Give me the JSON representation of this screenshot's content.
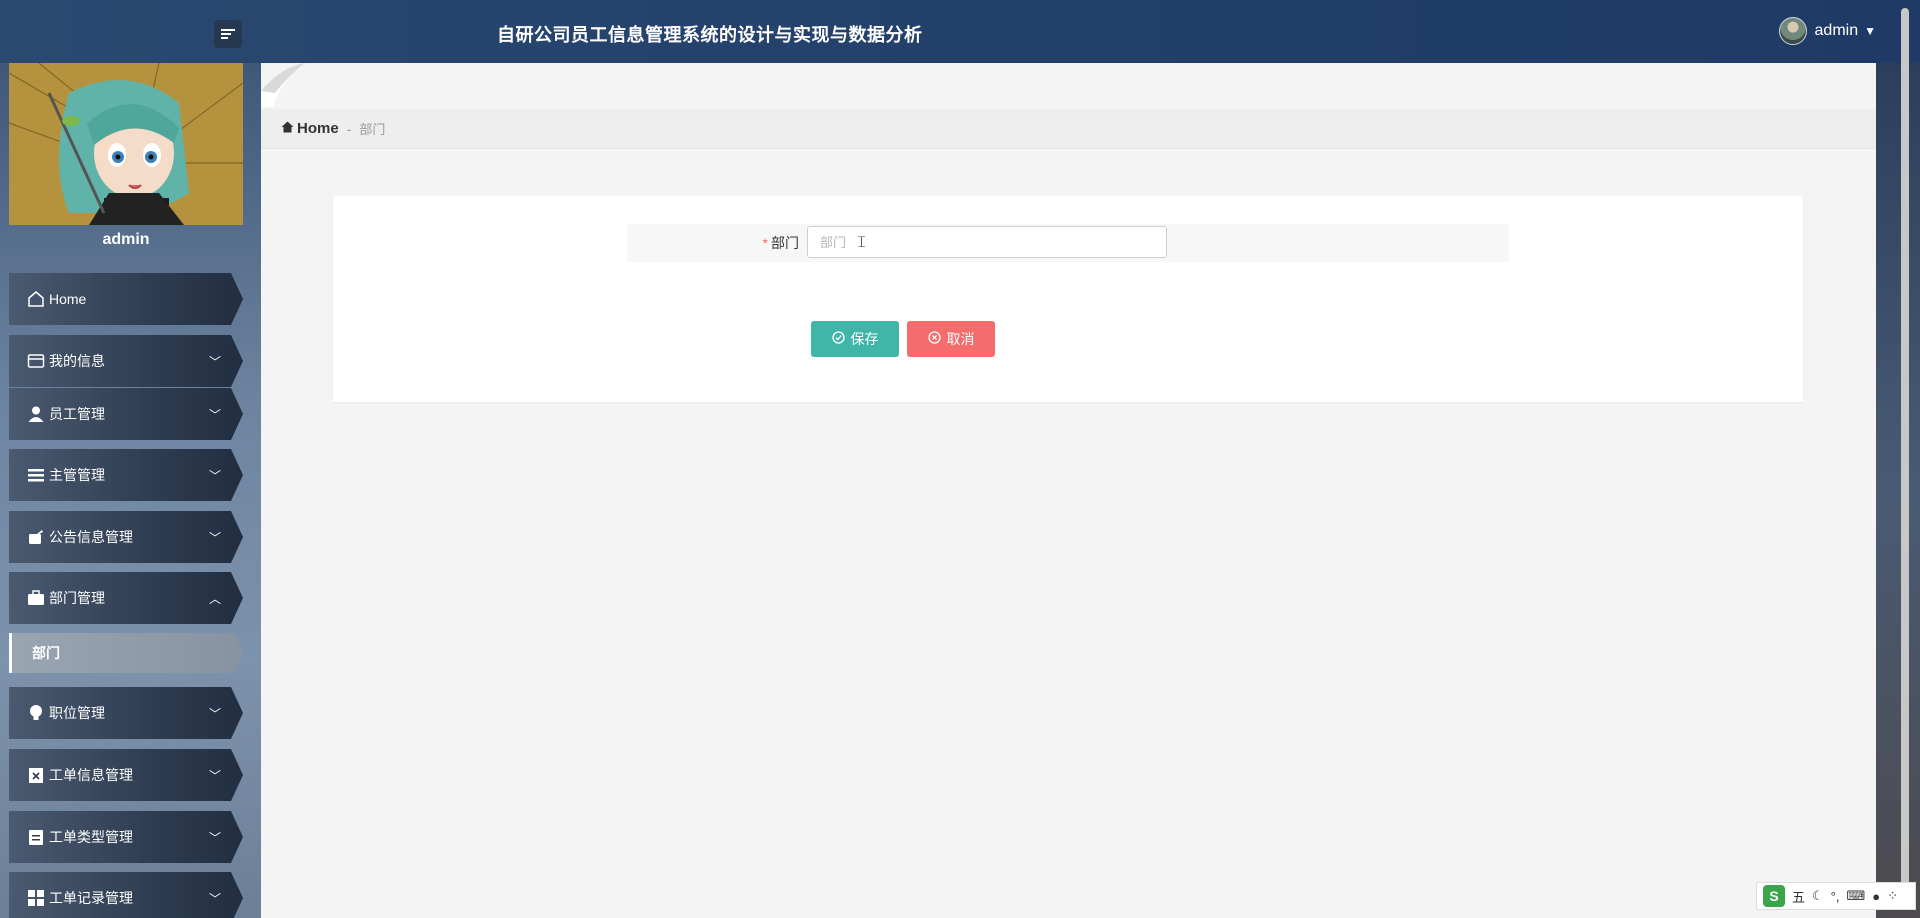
{
  "header": {
    "title": "自研公司员工信息管理系统的设计与实现与数据分析",
    "username": "admin"
  },
  "sidebar": {
    "username": "admin",
    "items": [
      {
        "label": "Home",
        "icon": "home-icon"
      },
      {
        "label": "我的信息",
        "icon": "wallet-icon"
      },
      {
        "label": "员工管理",
        "icon": "user-icon"
      },
      {
        "label": "主管管理",
        "icon": "list-icon"
      },
      {
        "label": "公告信息管理",
        "icon": "megaphone-icon"
      },
      {
        "label": "部门管理",
        "icon": "briefcase-icon",
        "expanded": true
      },
      {
        "label": "职位管理",
        "icon": "bulb-icon"
      },
      {
        "label": "工单信息管理",
        "icon": "clipboard-x-icon"
      },
      {
        "label": "工单类型管理",
        "icon": "clipboard-icon"
      },
      {
        "label": "工单记录管理",
        "icon": "grid-icon"
      }
    ],
    "submenu": {
      "label": "部门"
    }
  },
  "breadcrumb": {
    "home": "Home",
    "separator": "-",
    "current": "部门"
  },
  "form": {
    "field_label": "部门",
    "required_mark": "*",
    "field_placeholder": "部门",
    "field_value": "",
    "save_label": "保存",
    "cancel_label": "取消"
  },
  "ime": {
    "logo": "S",
    "mode": "五"
  },
  "colors": {
    "save": "#3fb6a8",
    "cancel": "#f56c6c",
    "required": "#f56c6c"
  }
}
